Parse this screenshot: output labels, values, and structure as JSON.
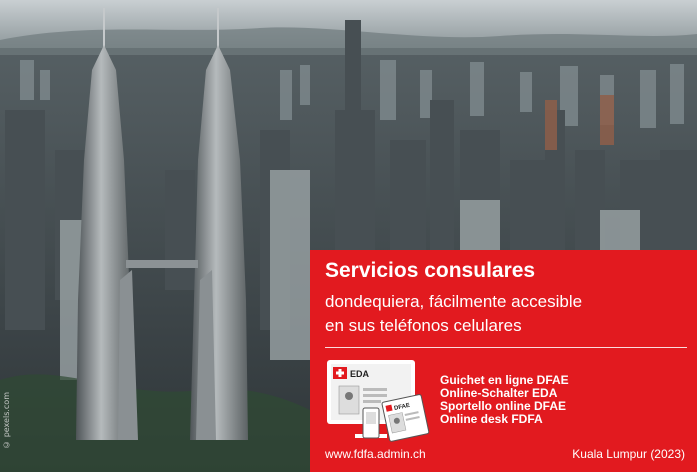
{
  "photo": {
    "credit": "© pexels.com"
  },
  "ad": {
    "title": "Servicios consulares",
    "subtitle_line1": "dondequiera, fácilmente accesible",
    "subtitle_line2": "en sus teléfonos celulares",
    "badge_label": "EDA",
    "tablet_label": "DFAE",
    "services": [
      "Guichet en ligne DFAE",
      "Online-Schalter EDA",
      "Sportello online DFAE",
      "Online desk FDFA"
    ],
    "url": "www.fdfa.admin.ch",
    "location": "Kuala Lumpur (2023)"
  },
  "colors": {
    "brand_red": "#e21a1f",
    "white": "#ffffff"
  }
}
